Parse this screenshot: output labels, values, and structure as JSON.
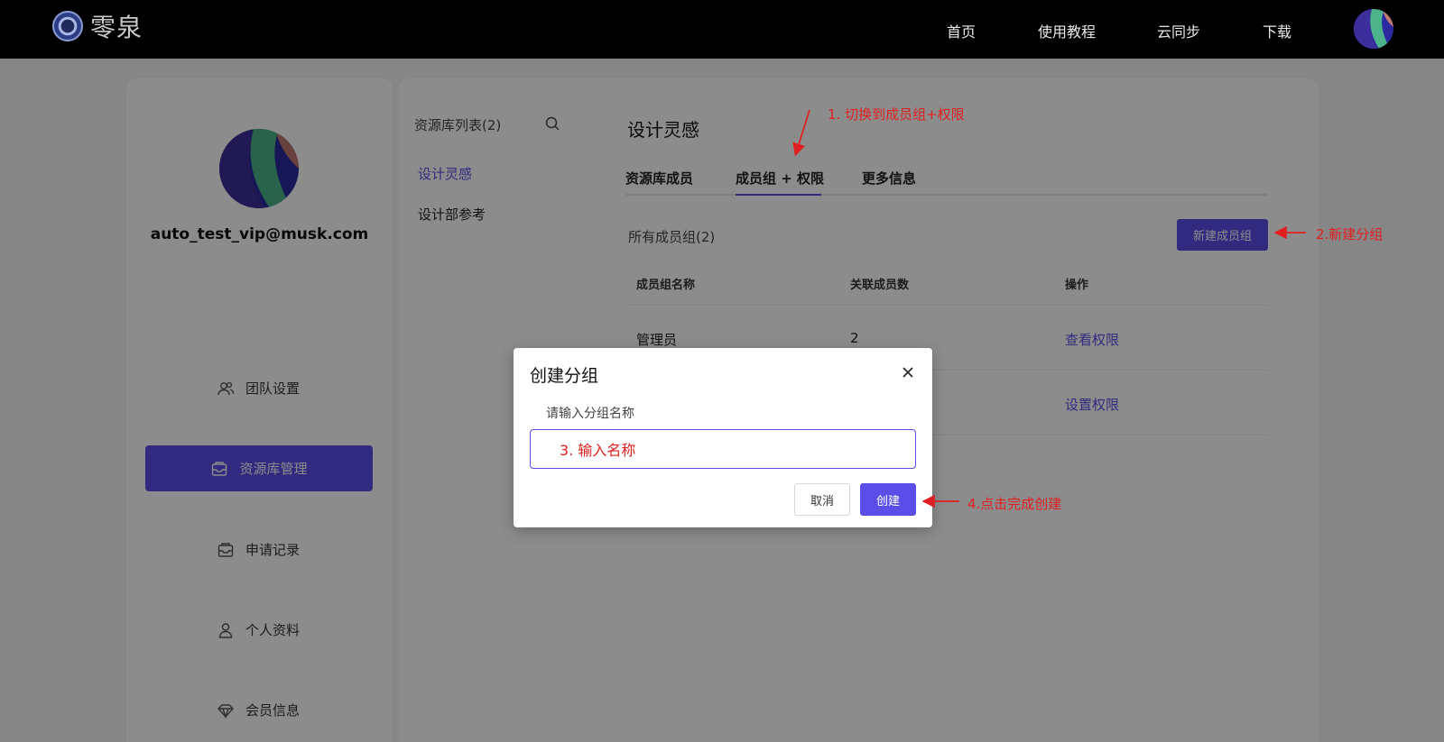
{
  "brand": {
    "name": "零泉"
  },
  "nav": {
    "items": [
      "首页",
      "使用教程",
      "云同步",
      "下载"
    ]
  },
  "user": {
    "email": "auto_test_vip@musk.com"
  },
  "sidebar": {
    "items": [
      {
        "label": "团队设置",
        "icon": "team-icon"
      },
      {
        "label": "资源库管理",
        "icon": "library-icon",
        "active": true
      },
      {
        "label": "申请记录",
        "icon": "inbox-icon"
      },
      {
        "label": "个人资料",
        "icon": "person-icon"
      },
      {
        "label": "会员信息",
        "icon": "diamond-icon"
      }
    ]
  },
  "library_list": {
    "title": "资源库列表(2)",
    "items": [
      "设计灵感",
      "设计部参考"
    ],
    "active_index": 0
  },
  "main": {
    "title": "设计灵感",
    "tabs": [
      "资源库成员",
      "成员组 + 权限",
      "更多信息"
    ],
    "active_tab": 1,
    "groups_label": "所有成员组(2)",
    "new_group_button": "新建成员组",
    "table": {
      "headers": [
        "成员组名称",
        "关联成员数",
        "操作"
      ],
      "rows": [
        {
          "name": "管理员",
          "count": "2",
          "action": "查看权限"
        },
        {
          "name": "",
          "count": "",
          "action": "设置权限"
        }
      ]
    }
  },
  "dialog": {
    "title": "创建分组",
    "label": "请输入分组名称",
    "input_value": "3. 输入名称",
    "cancel": "取消",
    "create": "创建"
  },
  "annotations": {
    "step1": "1. 切换到成员组+权限",
    "step2": "2.新建分组",
    "step4": "4.点击完成创建"
  },
  "colors": {
    "accent": "#5b4ee8",
    "annotation": "#e02020",
    "topbar": "#000000"
  }
}
